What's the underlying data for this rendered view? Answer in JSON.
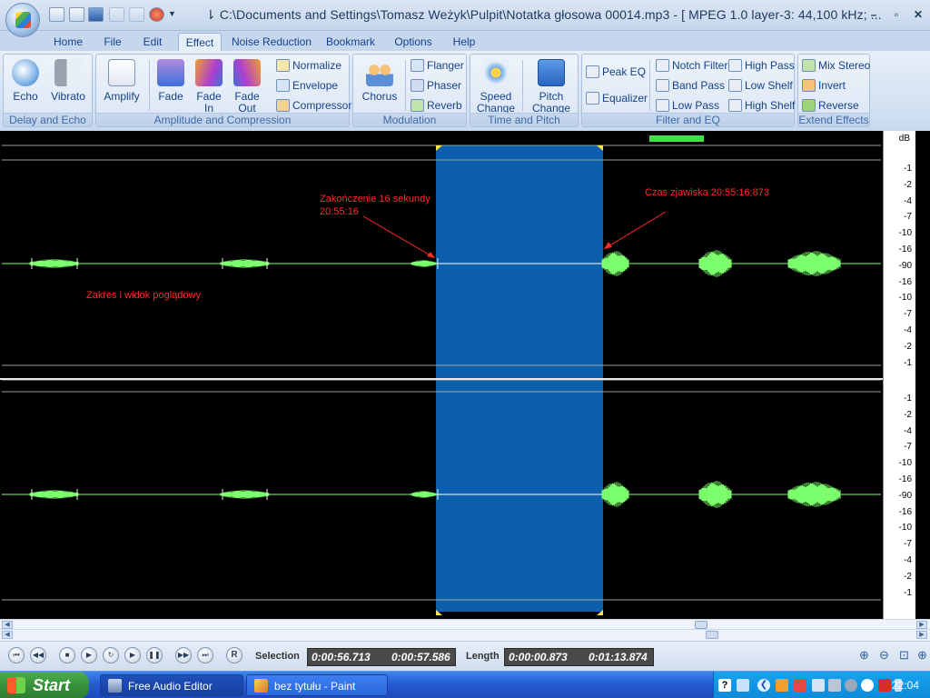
{
  "titlebar": {
    "title": "⇂ C:\\Documents and Settings\\Tomasz Weżyk\\Pulpit\\Notatka głosowa 00014.mp3 - [ MPEG 1.0 layer-3: 44,100 kHz; ...",
    "minimize": "–",
    "maximize": "▫",
    "close": "✕"
  },
  "tabs": [
    "Home",
    "File",
    "Edit",
    "Effect",
    "Noise Reduction",
    "Bookmark",
    "Options",
    "Help"
  ],
  "active_tab": "Effect",
  "ribbon": {
    "delay_echo": {
      "label": "Delay and Echo",
      "echo": "Echo",
      "vibrato": "Vibrato"
    },
    "amplitude": {
      "label": "Amplitude and Compression",
      "amplify": "Amplify",
      "fade": "Fade",
      "fade_in_1": "Fade",
      "fade_in_2": "In",
      "fade_out_1": "Fade",
      "fade_out_2": "Out",
      "normalize": "Normalize",
      "envelope": "Envelope",
      "compressor": "Compressor"
    },
    "modulation": {
      "label": "Modulation",
      "chorus": "Chorus",
      "flanger": "Flanger",
      "phaser": "Phaser",
      "reverb": "Reverb"
    },
    "time_pitch": {
      "label": "Time and Pitch",
      "speed_1": "Speed",
      "speed_2": "Change",
      "pitch_1": "Pitch",
      "pitch_2": "Change"
    },
    "filter_eq": {
      "label": "Filter and EQ",
      "peak_eq": "Peak EQ",
      "equalizer": "Equalizer",
      "notch": "Notch Filter",
      "band_pass": "Band Pass",
      "low_pass": "Low Pass",
      "high_pass": "High Pass",
      "low_shelf": "Low Shelf",
      "high_shelf": "High Shelf"
    },
    "extend": {
      "label": "Extend Effects",
      "mix_stereo": "Mix Stereo",
      "invert": "Invert",
      "reverse": "Reverse"
    }
  },
  "scale": {
    "unit": "dB",
    "top_channel": [
      "-1",
      "-2",
      "-4",
      "-7",
      "-10",
      "-16",
      "-90",
      "-16",
      "-10",
      "-7",
      "-4",
      "-2",
      "-1"
    ],
    "bottom_channel": [
      "-1",
      "-2",
      "-4",
      "-7",
      "-10",
      "-16",
      "-90",
      "-16",
      "-10",
      "-7",
      "-4",
      "-2",
      "-1"
    ]
  },
  "annotations": {
    "end_16s_line1": "Zakończenie 16 sekundy",
    "end_16s_line2": "20:55:16",
    "event_time": "Czas zjawiska 20:55:16;873",
    "range_view": "Zakres i widok poglądowy"
  },
  "transport": {
    "record": "R",
    "selection_label": "Selection",
    "selection_start": "0:00:56.713",
    "selection_end": "0:00:57.586",
    "length_label": "Length",
    "length_selection": "0:00:00.873",
    "length_total": "0:01:13.874"
  },
  "taskbar": {
    "start": "Start",
    "tasks": [
      "Free Audio Editor",
      "bez tytułu - Paint"
    ],
    "clock": "22:04"
  },
  "colors": {
    "waveform": "#7cff6c",
    "selection": "#0d5fac",
    "annotation": "#ff2a2a"
  }
}
